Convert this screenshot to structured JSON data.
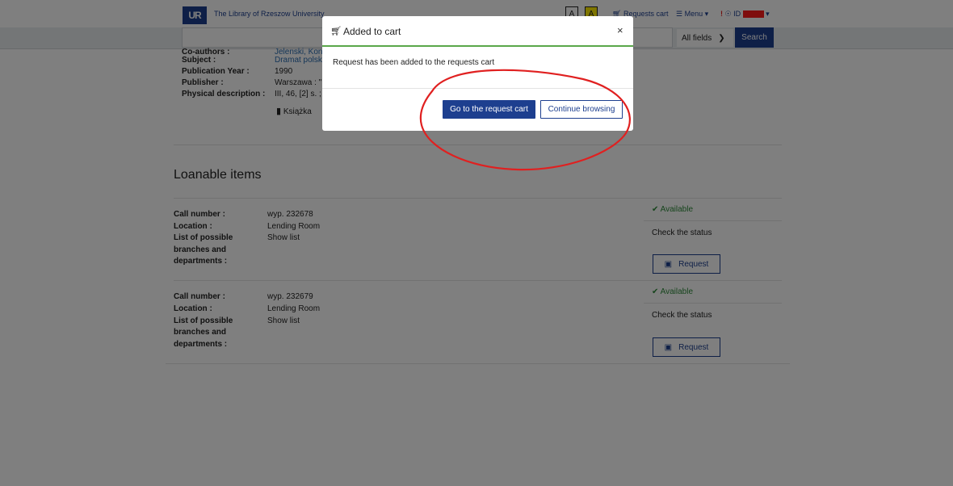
{
  "header": {
    "library_name": "The Library of Rzeszow University",
    "logo_text": "UR",
    "contrast_normal": "A",
    "contrast_high": "A",
    "requests_cart": "Requests cart",
    "menu": "Menu",
    "user_id": "ID"
  },
  "search": {
    "field_selector": "All fields",
    "button": "Search"
  },
  "record": {
    "rows": [
      {
        "label": "Co-authors :",
        "value": "Jelenski, Kon..."
      },
      {
        "label": "Subject :",
        "value": "Dramat polsk"
      },
      {
        "label": "Publication Year :",
        "value": "1990"
      },
      {
        "label": "Publisher :",
        "value": "Warszawa : \""
      },
      {
        "label": "Physical description :",
        "value": "III, 46, [2] s. ; 2"
      }
    ],
    "format": "Książka"
  },
  "loanable": {
    "title": "Loanable items",
    "items": [
      {
        "call_number_label": "Call number :",
        "call_number": "wyp. 232678",
        "location_label": "Location :",
        "location": "Lending Room",
        "list_label_1": "List of possible",
        "list_label_2": "branches and",
        "list_label_3": "departments :",
        "list_link": "Show list",
        "status": "Available",
        "check_status": "Check the status",
        "request": "Request"
      },
      {
        "call_number_label": "Call number :",
        "call_number": "wyp. 232679",
        "location_label": "Location :",
        "location": "Lending Room",
        "list_label_1": "List of possible",
        "list_label_2": "branches and",
        "list_label_3": "departments :",
        "list_link": "Show list",
        "status": "Available",
        "check_status": "Check the status",
        "request": "Request"
      }
    ]
  },
  "modal": {
    "title": "Added to cart",
    "close": "×",
    "message": "Request has been added to the requests cart",
    "primary_button": "Go to the request cart",
    "secondary_button": "Continue browsing"
  },
  "colors": {
    "primary": "#1d3f8f",
    "available": "#2e8b3a",
    "annotation": "#e02020"
  }
}
